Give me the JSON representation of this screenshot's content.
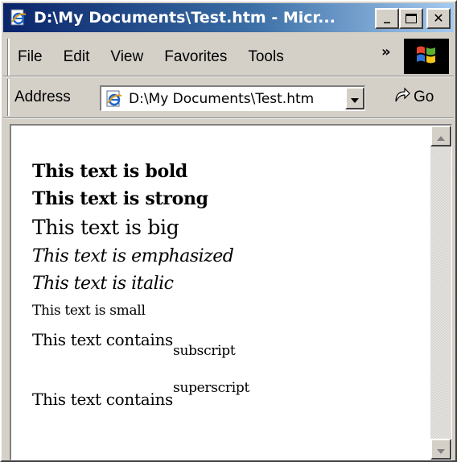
{
  "window": {
    "title": "D:\\My Documents\\Test.htm - Micr...",
    "minimize_glyph": "_",
    "maximize_glyph": "☐",
    "close_glyph": "✕"
  },
  "menu": {
    "items": [
      "File",
      "Edit",
      "View",
      "Favorites",
      "Tools"
    ],
    "more_glyph": "»"
  },
  "address": {
    "label": "Address",
    "value": "D:\\My Documents\\Test.htm",
    "go_label": "Go"
  },
  "document": {
    "bold": "This text is bold",
    "strong": "This text is strong",
    "big": "This text is big",
    "emphasized": "This text is emphasized",
    "italic": "This text is italic",
    "small": "This text is small",
    "sub_prefix": "This text contains",
    "sub_text": "subscript",
    "sup_prefix": "This text contains",
    "sup_text": "superscript"
  },
  "icons": {
    "ie_page": "ie-page-icon",
    "windows_logo": "windows-logo-icon",
    "go_arrow": "go-arrow-icon",
    "dropdown": "chevron-down-icon"
  },
  "colors": {
    "title_start": "#0a246a",
    "title_end": "#a6caf0",
    "chrome": "#d4d0c8",
    "page_bg": "#ffffff"
  }
}
